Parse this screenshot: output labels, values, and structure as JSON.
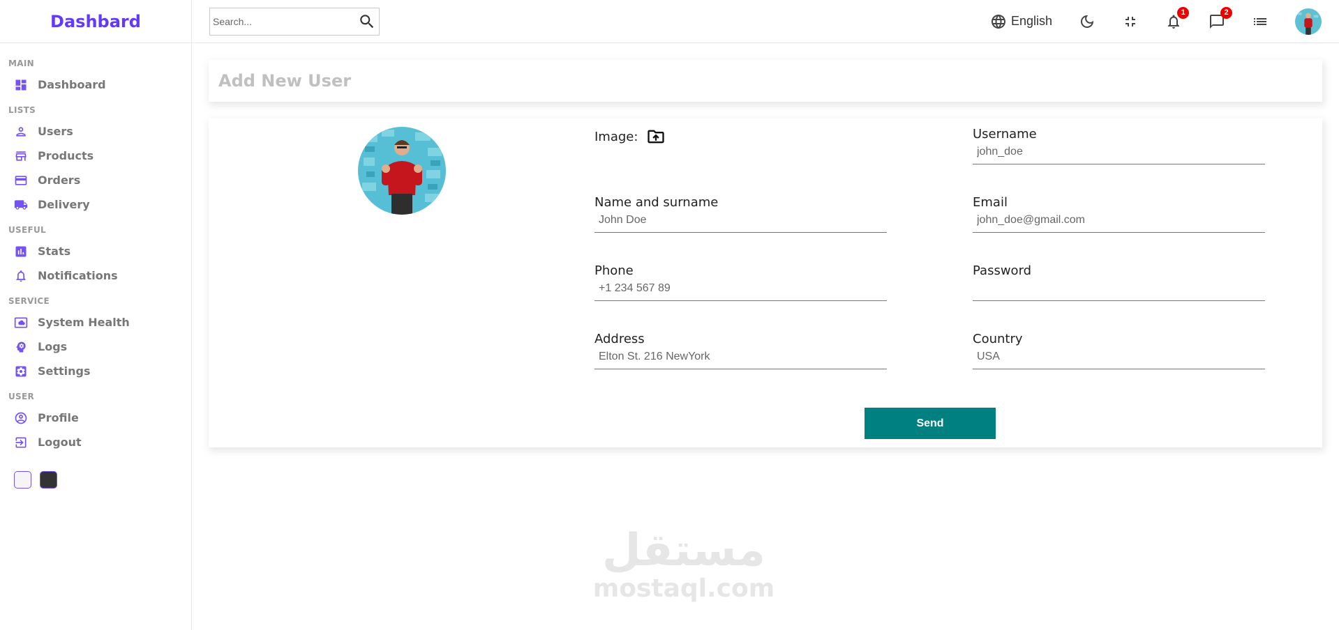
{
  "app": {
    "title": "Dashbard"
  },
  "sidebar": {
    "sections": [
      {
        "title": "MAIN",
        "items": [
          {
            "label": "Dashboard",
            "icon": "dashboard-icon"
          }
        ]
      },
      {
        "title": "LISTS",
        "items": [
          {
            "label": "Users",
            "icon": "person-icon"
          },
          {
            "label": "Products",
            "icon": "store-icon"
          },
          {
            "label": "Orders",
            "icon": "credit-card-icon"
          },
          {
            "label": "Delivery",
            "icon": "truck-icon"
          }
        ]
      },
      {
        "title": "USEFUL",
        "items": [
          {
            "label": "Stats",
            "icon": "bar-chart-icon"
          },
          {
            "label": "Notifications",
            "icon": "bell-icon"
          }
        ]
      },
      {
        "title": "SERVICE",
        "items": [
          {
            "label": "System Health",
            "icon": "cloud-icon"
          },
          {
            "label": "Logs",
            "icon": "psychology-icon"
          },
          {
            "label": "Settings",
            "icon": "settings-icon"
          }
        ]
      },
      {
        "title": "USER",
        "items": [
          {
            "label": "Profile",
            "icon": "account-circle-icon"
          },
          {
            "label": "Logout",
            "icon": "logout-icon"
          }
        ]
      }
    ]
  },
  "topbar": {
    "search_placeholder": "Search...",
    "language": "English",
    "notifications_count": "1",
    "messages_count": "2"
  },
  "page": {
    "title": "Add New User"
  },
  "form": {
    "image_label": "Image:",
    "fields": {
      "username": {
        "label": "Username",
        "placeholder": "john_doe"
      },
      "name": {
        "label": "Name and surname",
        "placeholder": "John Doe"
      },
      "email": {
        "label": "Email",
        "placeholder": "john_doe@gmail.com"
      },
      "phone": {
        "label": "Phone",
        "placeholder": "+1 234 567 89"
      },
      "password": {
        "label": "Password",
        "placeholder": ""
      },
      "address": {
        "label": "Address",
        "placeholder": "Elton St. 216 NewYork"
      },
      "country": {
        "label": "Country",
        "placeholder": "USA"
      }
    },
    "send_label": "Send"
  },
  "watermark": {
    "arabic": "مستقل",
    "latin": "mostaql.com"
  },
  "colors": {
    "accent": "#6439ff",
    "icon": "#7451f8",
    "button": "#008080",
    "badge": "#e00000"
  }
}
